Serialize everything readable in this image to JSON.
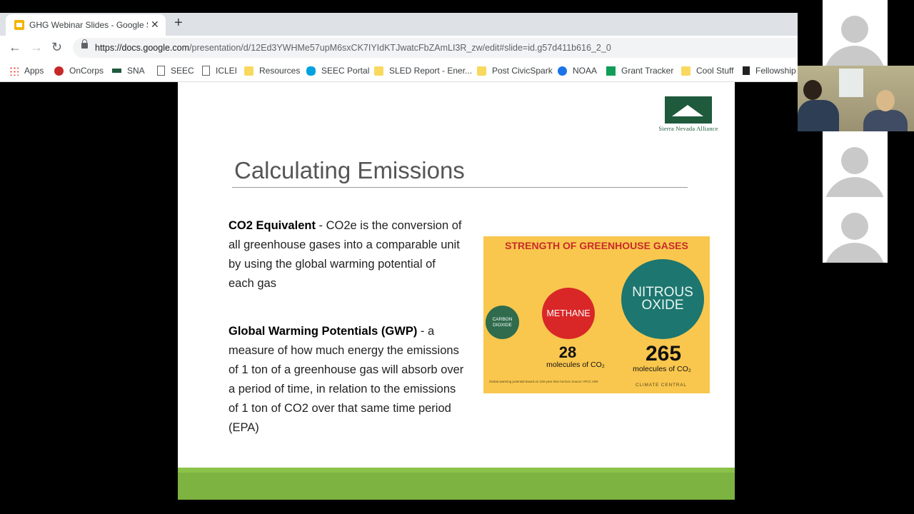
{
  "browser": {
    "tab_title": "GHG Webinar Slides - Google Sli",
    "tab_close": "✕",
    "new_tab": "+",
    "url_host": "https://docs.google.com",
    "url_path": "/presentation/d/12Ed3YWHMe57upM6sxCK7IYIdKTJwatcFbZAmLI3R_zw/edit#slide=id.g57d411b616_2_0",
    "nav": {
      "back": "←",
      "forward": "→",
      "reload": "↻"
    },
    "bookmarks": [
      "Apps",
      "OnCorps",
      "SNA",
      "SEEC",
      "ICLEI",
      "Resources",
      "SEEC Portal",
      "SLED Report - Ener...",
      "Post CivicSpark",
      "NOAA",
      "Grant Tracker",
      "Cool Stuff",
      "Fellowship"
    ]
  },
  "slide": {
    "logo_text": "Sierra Nevada Alliance",
    "title": "Calculating Emissions",
    "p1_bold": "CO2 Equivalent",
    "p1_text": " - CO2e is the conversion of all greenhouse gases into a comparable unit by using the global warming potential of each gas",
    "p2_bold": "Global Warming Potentials (GWP)",
    "p2_text": " - a measure of how much energy the emissions of 1 ton of a greenhouse gas will absorb over a period of time, in relation to the emissions of 1 ton of CO2 over that same time period (EPA)"
  },
  "infographic": {
    "header": "STRENGTH OF GREENHOUSE GASES",
    "gas1": "CARBON DIOXIDE",
    "gas2": "METHANE",
    "gas3": "NITROUS OXIDE",
    "value2": "28",
    "unit2": "molecules of CO₂",
    "value3": "265",
    "unit3": "molecules of CO₂",
    "source": "Global warming potential based on 100-year time horizon Source: IPCC AR5",
    "brand": "CLIMATE CENTRAL"
  }
}
